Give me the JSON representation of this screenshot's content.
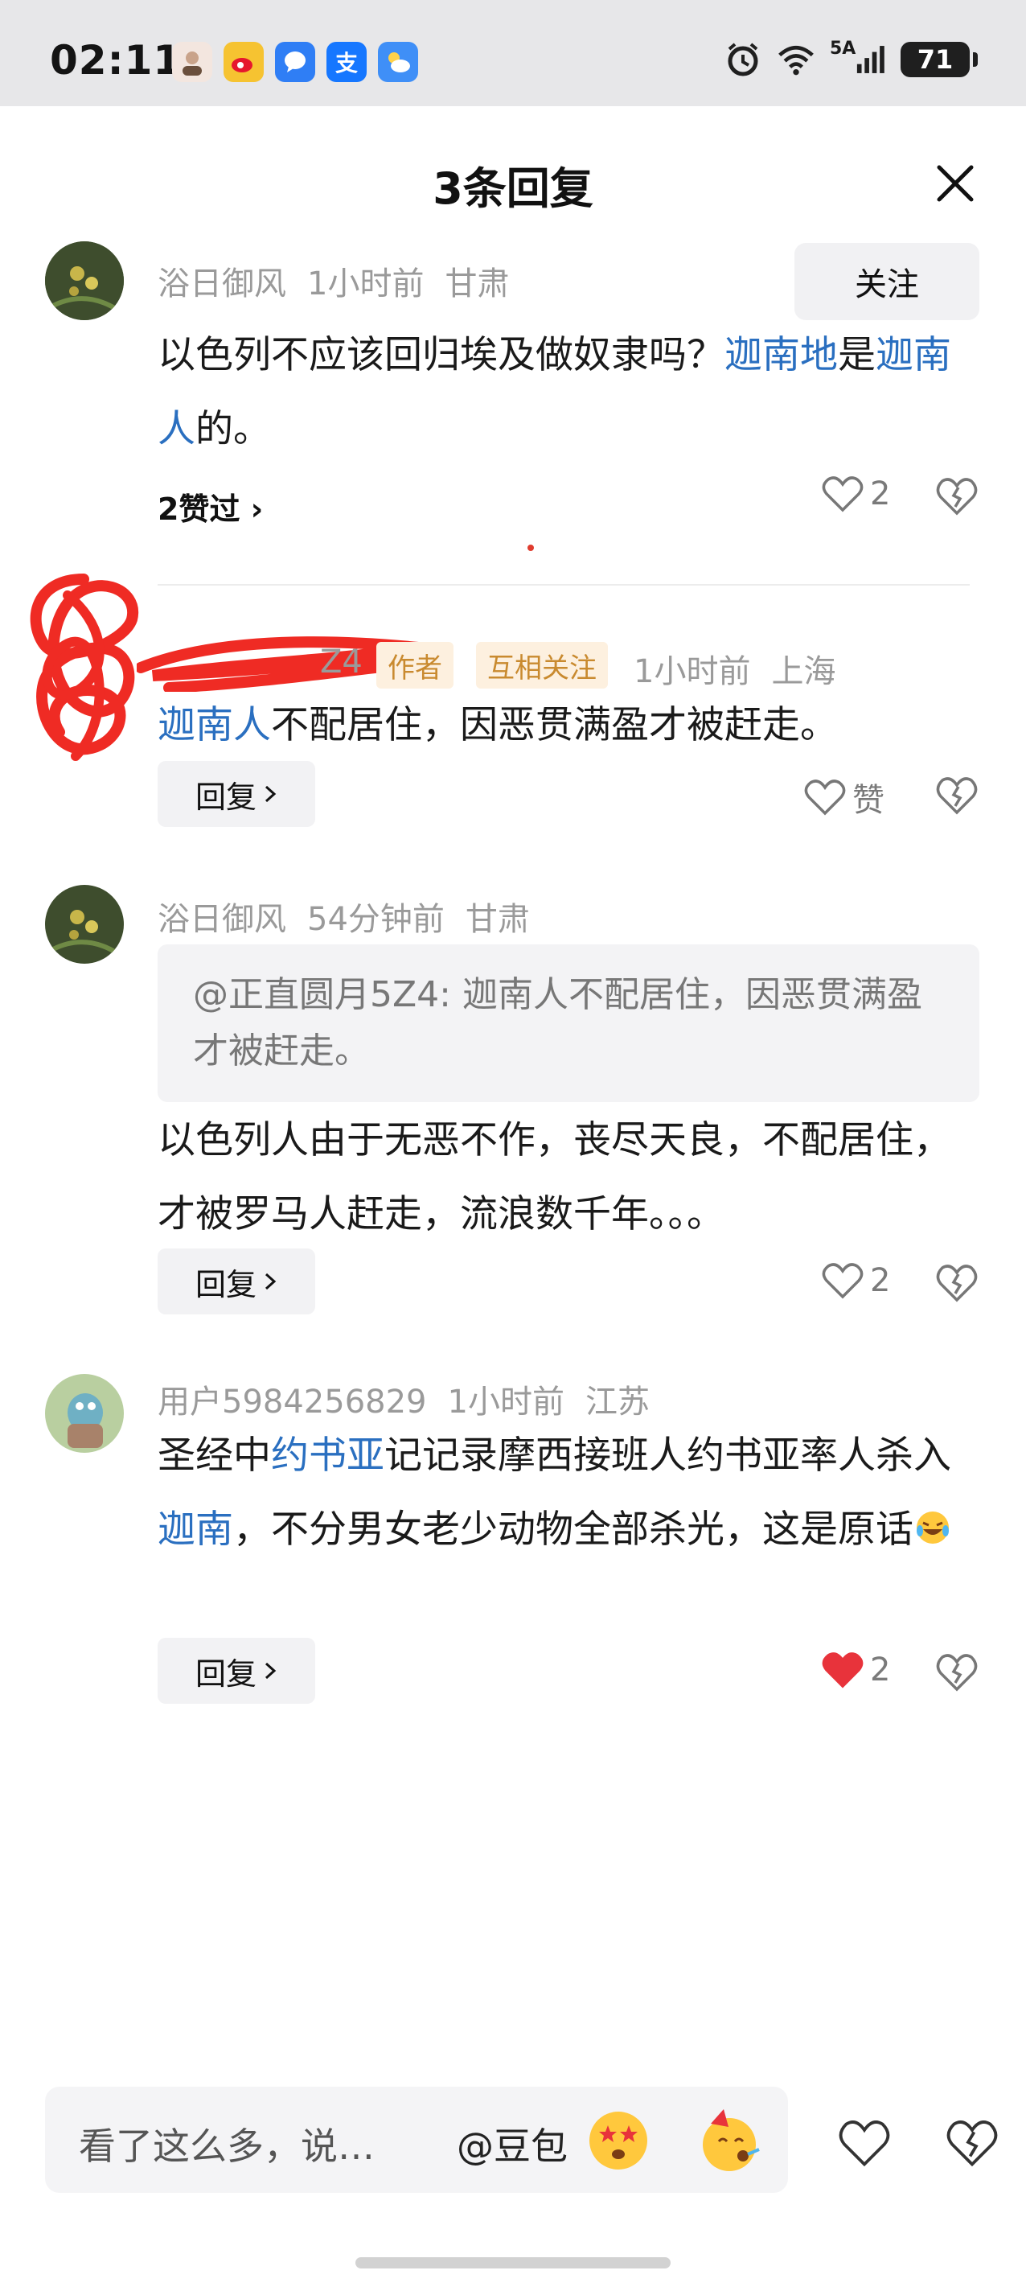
{
  "status_bar": {
    "time": "02:11",
    "network": "5A",
    "battery": "71",
    "app_icons": [
      "avatar-icon",
      "weibo-icon",
      "message-icon",
      "alipay-icon",
      "weather-icon"
    ],
    "alipay_glyph": "支"
  },
  "header": {
    "title": "3条回复"
  },
  "comments": [
    {
      "user": "浴日御风",
      "time": "1小时前",
      "location": "甘肃",
      "follow_label": "关注",
      "text_parts": [
        "以色列不应该回归埃及做奴隶吗？",
        "迦南地",
        "是",
        "迦南人",
        "的。"
      ],
      "likes_link": "2赞过 ›",
      "like_count": "2"
    },
    {
      "user_suffix": "Z4",
      "author_tag": "作者",
      "mutual_tag": "互相关注",
      "time": "1小时前",
      "location": "上海",
      "text_parts": [
        "迦南人",
        "不配居住，因恶贯满盈才被赶走。"
      ],
      "reply_label": "回复",
      "like_label": "赞"
    },
    {
      "user": "浴日御风",
      "time": "54分钟前",
      "location": "甘肃",
      "quote": "@正直圆月5Z4: 迦南人不配居住，因恶贯满盈才被赶走。",
      "text": "以色列人由于无恶不作，丧尽天良，不配居住，才被罗马人赶走，流浪数千年。。。",
      "reply_label": "回复",
      "like_count": "2"
    },
    {
      "user": "用户5984256829",
      "time": "1小时前",
      "location": "江苏",
      "text_parts": [
        "圣经中",
        "约书亚",
        "记记录摩西接班人约书亚率人杀入",
        "迦南",
        "，不分男女老少动物全部杀光，这是原话"
      ],
      "reply_label": "回复",
      "like_count": "2",
      "liked": true
    }
  ],
  "input": {
    "placeholder": "看了这么多，说…",
    "mention": "@豆包"
  },
  "colors": {
    "link": "#2a6fc0",
    "liked": "#e8333b",
    "tag_bg": "#fdf0df",
    "tag_text": "#c98a2f"
  }
}
